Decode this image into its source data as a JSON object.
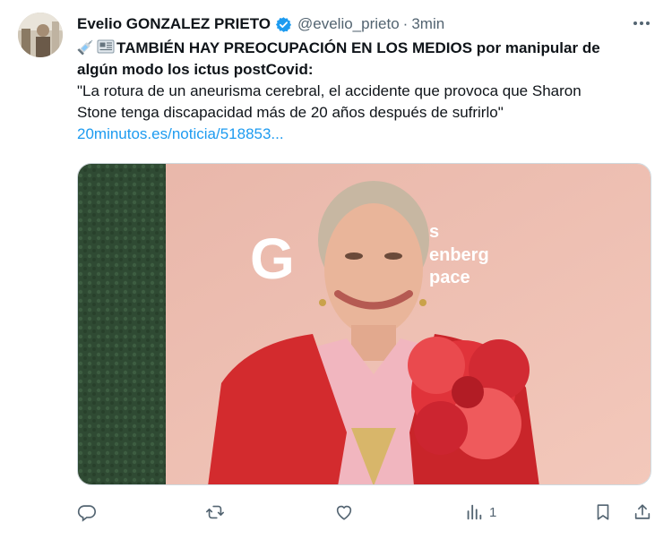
{
  "author": {
    "display_name": "Evelio GONZALEZ PRIETO",
    "handle": "@evelio_prieto",
    "separator": "·",
    "time": "3min",
    "verified_icon": "verified-badge-icon",
    "accent_color": "#1d9bf0"
  },
  "tweet": {
    "bold_text_line1": "TAMBIÉN HAY PREOCUPACIÓN EN LOS MEDIOS por manipular de",
    "bold_text_line2": "algún modo los ictus postCovid:",
    "quote_line1": "\"La rotura de un aneurisma cerebral, el accidente que provoca que Sharon",
    "quote_line2": "Stone tenga discapacidad más de 20 años después de sufrirlo\"",
    "link_text": "20minutos.es/noticia/518853...",
    "emoji_icons": [
      "syringe-icon",
      "newspaper-icon"
    ]
  },
  "media": {
    "backdrop_logo_letter": "G",
    "backdrop_text_line1": "s",
    "backdrop_text_line2": "enberg",
    "backdrop_text_line3": "pace"
  },
  "actions": {
    "reply_icon": "reply-icon",
    "retweet_icon": "retweet-icon",
    "like_icon": "heart-icon",
    "views_icon": "views-chart-icon",
    "views_count": "1",
    "bookmark_icon": "bookmark-icon",
    "share_icon": "share-icon",
    "icon_color": "#536471"
  }
}
